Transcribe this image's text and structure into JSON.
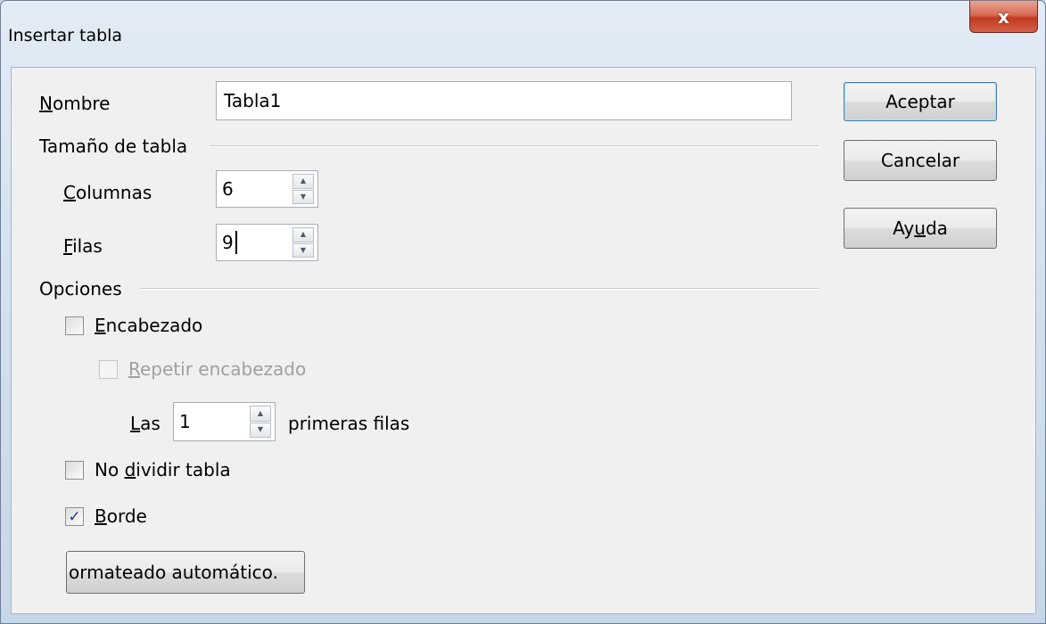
{
  "window": {
    "title": "Insertar tabla",
    "close_glyph": "x"
  },
  "name_field": {
    "label_pre": "",
    "label_key": "N",
    "label_post": "ombre",
    "value": "Tabla1"
  },
  "table_size": {
    "section_label": "Tamaño de tabla",
    "columns": {
      "label_key": "C",
      "label_post": "olumnas",
      "value": "6"
    },
    "rows": {
      "label_key": "F",
      "label_post": "ilas",
      "value": "9"
    }
  },
  "options": {
    "section_label": "Opciones",
    "header": {
      "label_key": "E",
      "label_post": "ncabezado",
      "checked": false
    },
    "repeat_header": {
      "label_key": "R",
      "label_post": "epetir encabezado",
      "checked": false,
      "enabled": false
    },
    "first_rows": {
      "label_key": "L",
      "label_post": "as",
      "value": "1",
      "suffix": "primeras filas"
    },
    "no_split": {
      "label_pre": "No ",
      "label_key": "d",
      "label_post": "ividir tabla",
      "checked": false
    },
    "border": {
      "label_key": "B",
      "label_post": "orde",
      "checked": true
    },
    "autoformat_label": "ormateado automático."
  },
  "buttons": {
    "ok": "Aceptar",
    "cancel": "Cancelar",
    "help_pre": "Ay",
    "help_key": "u",
    "help_post": "da"
  },
  "icons": {
    "spin_up": "▲",
    "spin_down": "▼",
    "check": "✓"
  }
}
